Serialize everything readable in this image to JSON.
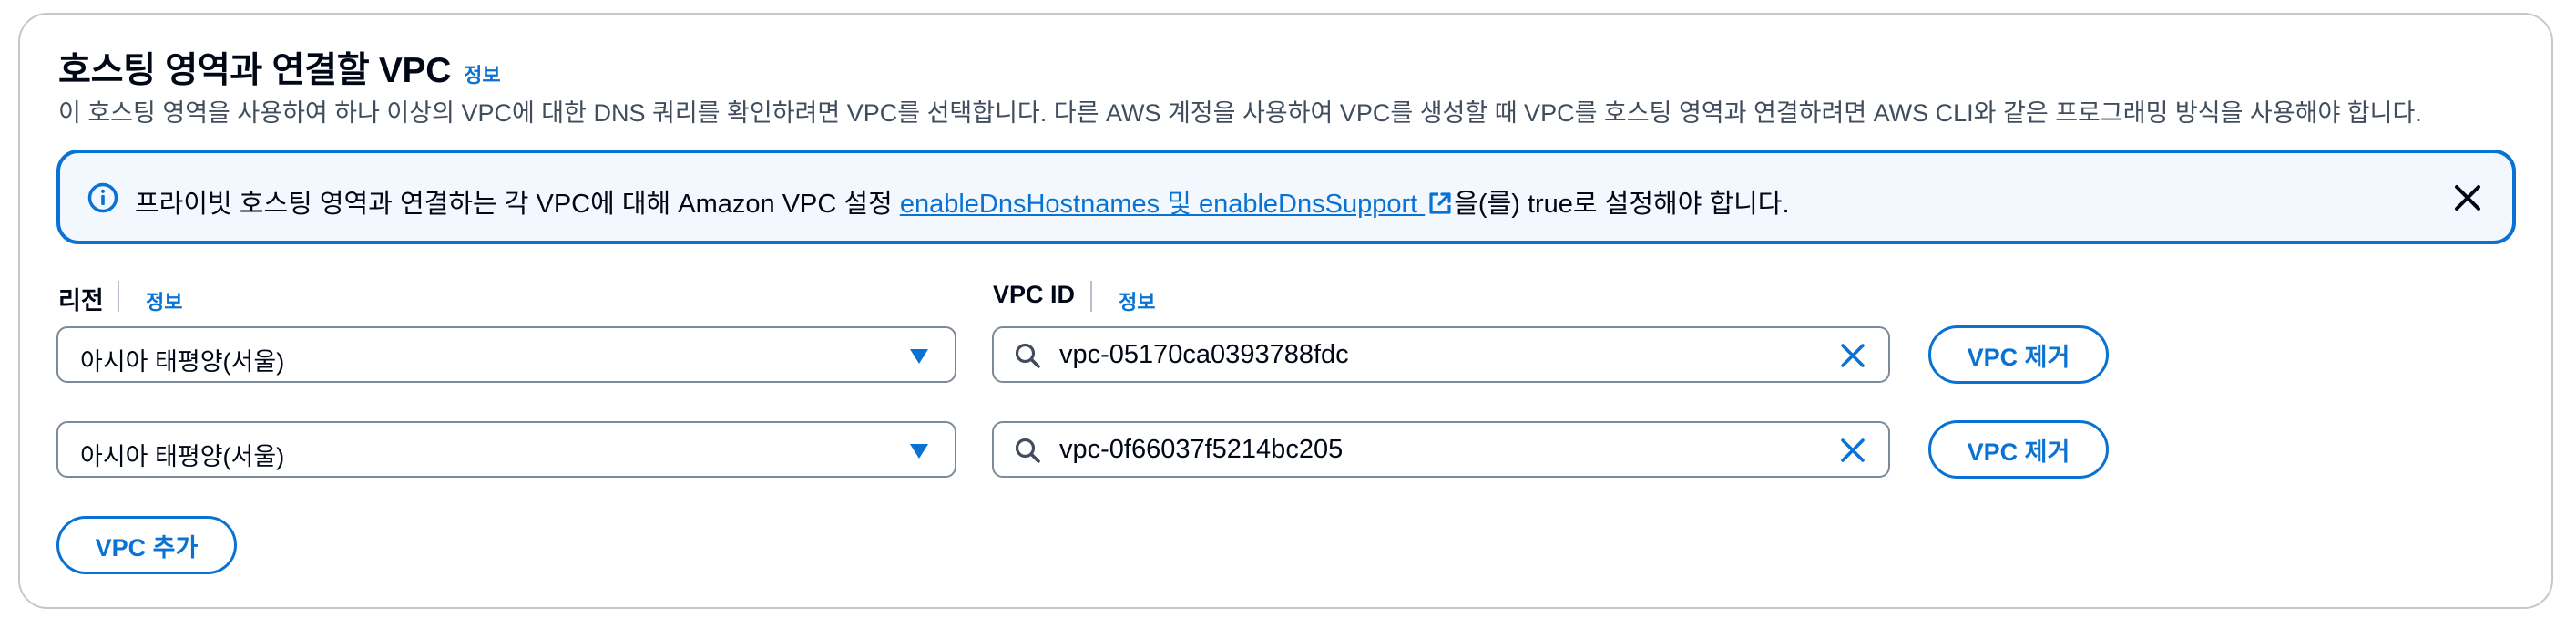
{
  "section": {
    "title": "호스팅 영역과 연결할 VPC",
    "info_label": "정보",
    "description": "이 호스팅 영역을 사용하여 하나 이상의 VPC에 대한 DNS 쿼리를 확인하려면 VPC를 선택합니다. 다른 AWS 계정을 사용하여 VPC를 생성할 때 VPC를 호스팅 영역과 연결하려면 AWS CLI와 같은 프로그래밍 방식을 사용해야 합니다."
  },
  "alert": {
    "text_before": "프라이빗 호스팅 영역과 연결하는 각 VPC에 대해 Amazon VPC 설정 ",
    "link_text": "enableDnsHostnames 및 enableDnsSupport ",
    "text_after": "을(를) true로 설정해야 합니다.",
    "icon": "info-icon",
    "close_icon": "close-icon",
    "color": "#0972d3"
  },
  "fields": {
    "region_label": "리전",
    "region_info": "정보",
    "vpc_label": "VPC ID",
    "vpc_info": "정보"
  },
  "rows": [
    {
      "region": "아시아 태평양(서울)",
      "vpc_id": "vpc-05170ca0393788fdc",
      "remove_label": "VPC 제거"
    },
    {
      "region": "아시아 태평양(서울)",
      "vpc_id": "vpc-0f66037f5214bc205",
      "remove_label": "VPC 제거"
    }
  ],
  "add_button": "VPC 추가",
  "colors": {
    "accent": "#0972d3",
    "border": "#7d8998",
    "alert_bg": "#f2f8fd",
    "text": "#000716"
  }
}
